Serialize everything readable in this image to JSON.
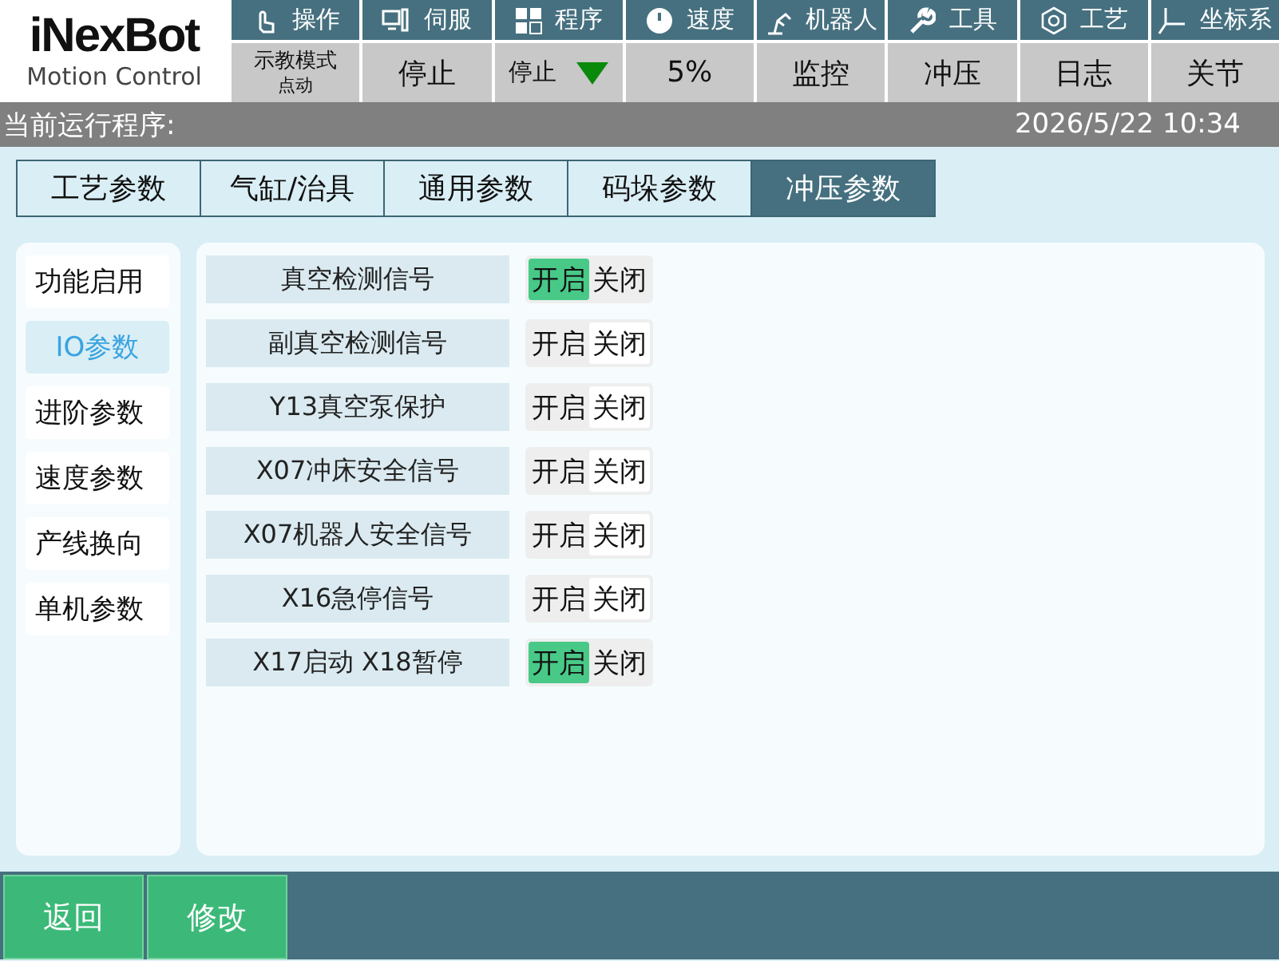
{
  "logo": {
    "brand_top": "iNexBot",
    "brand_bottom": "Motion Control"
  },
  "top_menu": [
    {
      "label": "操作",
      "value": "示教模式",
      "sub": "点动"
    },
    {
      "label": "伺服",
      "value": "停止"
    },
    {
      "label": "程序",
      "value": "停止",
      "indicator": true
    },
    {
      "label": "速度",
      "value": "5%"
    },
    {
      "label": "机器人",
      "value": "监控"
    },
    {
      "label": "工具",
      "value": "冲压"
    },
    {
      "label": "工艺",
      "value": "日志"
    },
    {
      "label": "坐标系",
      "value": "关节"
    }
  ],
  "status_bar": {
    "program": "当前运行程序:",
    "datetime": "2026/5/22 10:34"
  },
  "tabs": [
    {
      "label": "工艺参数",
      "selected": false
    },
    {
      "label": "气缸/治具",
      "selected": false
    },
    {
      "label": "通用参数",
      "selected": false
    },
    {
      "label": "码垛参数",
      "selected": false
    },
    {
      "label": "冲压参数",
      "selected": true
    }
  ],
  "sidebar": {
    "items": [
      {
        "label": "功能启用",
        "selected": false
      },
      {
        "label": "IO参数",
        "selected": true
      },
      {
        "label": "进阶参数",
        "selected": false
      },
      {
        "label": "速度参数",
        "selected": false
      },
      {
        "label": "产线换向",
        "selected": false
      },
      {
        "label": "单机参数",
        "selected": false
      }
    ]
  },
  "settings": [
    {
      "name": "真空检测信号",
      "on_label": "开启",
      "off_label": "关闭",
      "on": true
    },
    {
      "name": "副真空检测信号",
      "on_label": "开启",
      "off_label": "关闭",
      "on": false
    },
    {
      "name": "Y13真空泵保护",
      "on_label": "开启",
      "off_label": "关闭",
      "on": false
    },
    {
      "name": "X07冲床安全信号",
      "on_label": "开启",
      "off_label": "关闭",
      "on": false
    },
    {
      "name": "X07机器人安全信号",
      "on_label": "开启",
      "off_label": "关闭",
      "on": false
    },
    {
      "name": "X16急停信号",
      "on_label": "开启",
      "off_label": "关闭",
      "on": false
    },
    {
      "name": "X17启动 X18暂停",
      "on_label": "开启",
      "off_label": "关闭",
      "on": true
    }
  ],
  "buttons": [
    "返回",
    "修改"
  ]
}
